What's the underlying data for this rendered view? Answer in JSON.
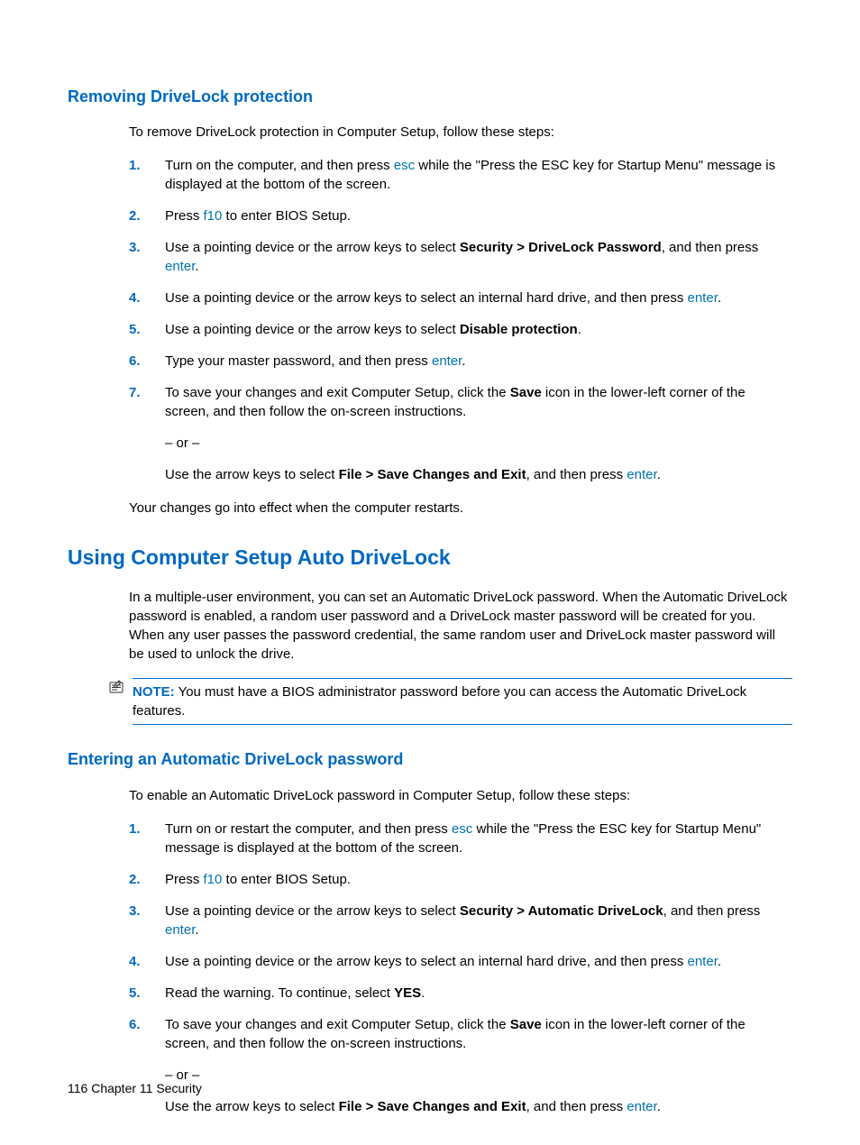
{
  "section1": {
    "heading": "Removing DriveLock protection",
    "intro": "To remove DriveLock protection in Computer Setup, follow these steps:",
    "steps": {
      "s1a": "Turn on the computer, and then press ",
      "s1b": " while the \"Press the ESC key for Startup Menu\" message is displayed at the bottom of the screen.",
      "s2a": "Press ",
      "s2b": " to enter BIOS Setup.",
      "s3a": "Use a pointing device or the arrow keys to select ",
      "s3b": "Security > DriveLock Password",
      "s3c": ", and then press ",
      "s4a": "Use a pointing device or the arrow keys to select an internal hard drive, and then press ",
      "s5a": "Use a pointing device or the arrow keys to select ",
      "s5b": "Disable protection",
      "s6a": "Type your master password, and then press ",
      "s7a": "To save your changes and exit Computer Setup, click the ",
      "s7b": "Save",
      "s7c": " icon in the lower-left corner of the screen, and then follow the on-screen instructions.",
      "s7or": "– or –",
      "s7d": "Use the arrow keys to select ",
      "s7e": "File > Save Changes and Exit",
      "s7f": ", and then press "
    },
    "outro": "Your changes go into effect when the computer restarts."
  },
  "section2": {
    "heading": "Using Computer Setup Auto DriveLock",
    "intro": "In a multiple-user environment, you can set an Automatic DriveLock password. When the Automatic DriveLock password is enabled, a random user password and a DriveLock master password will be created for you. When any user passes the password credential, the same random user and DriveLock master password will be used to unlock the drive.",
    "note_label": "NOTE:",
    "note_body": "   You must have a BIOS administrator password before you can access the Automatic DriveLock features."
  },
  "section3": {
    "heading": "Entering an Automatic DriveLock password",
    "intro": "To enable an Automatic DriveLock password in Computer Setup, follow these steps:",
    "steps": {
      "s1a": "Turn on or restart the computer, and then press ",
      "s1b": " while the \"Press the ESC key for Startup Menu\" message is displayed at the bottom of the screen.",
      "s2a": "Press ",
      "s2b": " to enter BIOS Setup.",
      "s3a": "Use a pointing device or the arrow keys to select ",
      "s3b": "Security > Automatic DriveLock",
      "s3c": ", and then press ",
      "s4a": "Use a pointing device or the arrow keys to select an internal hard drive, and then press ",
      "s5a": "Read the warning. To continue, select ",
      "s5b": "YES",
      "s6a": "To save your changes and exit Computer Setup, click the ",
      "s6b": "Save",
      "s6c": " icon in the lower-left corner of the screen, and then follow the on-screen instructions.",
      "s6or": "– or –",
      "s6d": "Use the arrow keys to select ",
      "s6e": "File > Save Changes and Exit",
      "s6f": ", and then press "
    }
  },
  "keys": {
    "esc": "esc",
    "f10": "f10",
    "enter": "enter"
  },
  "nums": {
    "n1": "1.",
    "n2": "2.",
    "n3": "3.",
    "n4": "4.",
    "n5": "5.",
    "n6": "6.",
    "n7": "7."
  },
  "period": ".",
  "footer": {
    "page": "116",
    "chapter": "   Chapter 11   Security"
  }
}
